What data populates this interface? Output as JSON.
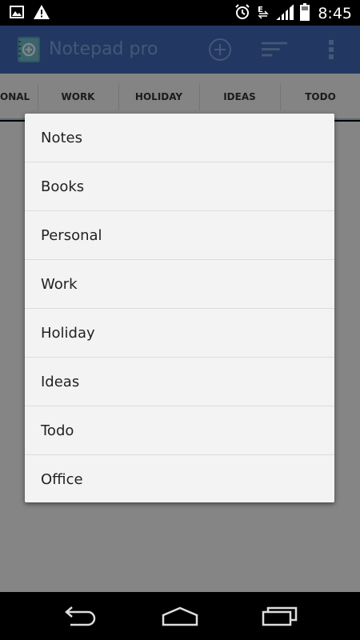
{
  "status_bar": {
    "time": "8:45",
    "icons": [
      "image-icon",
      "warning-icon",
      "alarm-icon",
      "data-icon",
      "signal-icon",
      "battery-icon"
    ]
  },
  "app_bar": {
    "title": "Notepad pro",
    "logo": "notepad-logo-icon",
    "actions": [
      "add-icon",
      "sort-icon",
      "overflow-icon"
    ]
  },
  "tabs": [
    "ONAL",
    "WORK",
    "HOLIDAY",
    "IDEAS",
    "TODO"
  ],
  "category_dialog": {
    "items": [
      "Notes",
      "Books",
      "Personal",
      "Work",
      "Holiday",
      "Ideas",
      "Todo",
      "Office"
    ]
  },
  "nav_bar": {
    "buttons": [
      "back-icon",
      "home-icon",
      "recents-icon"
    ]
  },
  "colors": {
    "app_bar": "#3f66b3",
    "title": "#7f9fd6",
    "tab_indicator": "#9ac7cf",
    "dialog_bg": "#f3f3f3"
  }
}
